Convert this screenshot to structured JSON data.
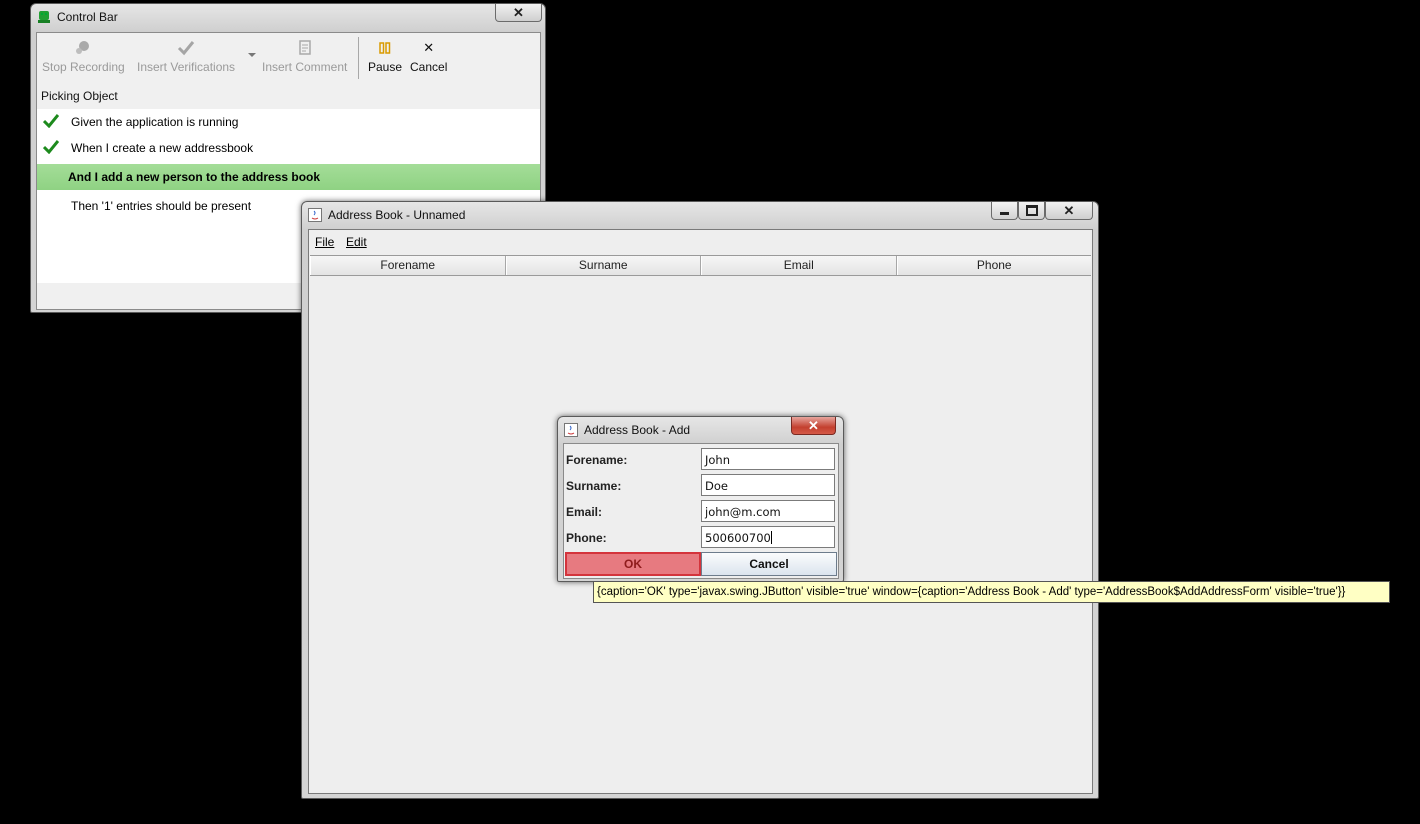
{
  "control_bar": {
    "title": "Control Bar",
    "icon": "robot-icon",
    "toolbar": {
      "stop_recording": "Stop Recording",
      "insert_verifications": "Insert Verifications",
      "insert_comment": "Insert Comment",
      "pause": "Pause",
      "cancel": "Cancel"
    },
    "status": "Picking Object",
    "steps": [
      {
        "text": "Given the application is running",
        "done": true
      },
      {
        "text": "When I create a new addressbook",
        "done": true
      },
      {
        "text": "And I add a new person to the address book",
        "current": true
      },
      {
        "text": "Then '1' entries should be present",
        "done": false
      }
    ]
  },
  "address_book": {
    "title": "Address Book - Unnamed",
    "menu": {
      "file": "File",
      "edit": "Edit"
    },
    "columns": [
      "Forename",
      "Surname",
      "Email",
      "Phone"
    ]
  },
  "add_dialog": {
    "title": "Address Book - Add",
    "fields": [
      {
        "label": "Forename:",
        "value": "John"
      },
      {
        "label": "Surname:",
        "value": "Doe"
      },
      {
        "label": "Email:",
        "value": "john@m.com"
      },
      {
        "label": "Phone:",
        "value": "500600700"
      }
    ],
    "ok": "OK",
    "cancel": "Cancel"
  },
  "tooltip": "{caption='OK' type='javax.swing.JButton' visible='true' window={caption='Address Book - Add' type='AddressBook$AddAddressForm' visible='true'}}",
  "colors": {
    "highlight_step": "#9bd88e",
    "ok_button": "#e77a80",
    "tooltip_bg": "#ffffc4"
  }
}
